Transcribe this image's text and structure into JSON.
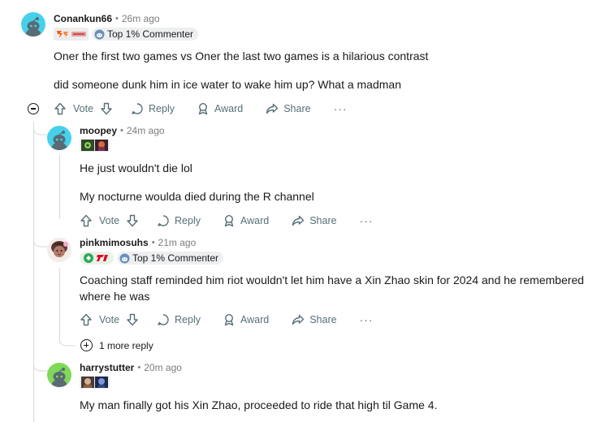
{
  "comments": [
    {
      "username": "Conankun66",
      "time": "26m ago",
      "flair_text": "Top 1% Commenter",
      "flair_icons": [
        "fnatic-logo-icon",
        "team-badge-icon"
      ],
      "paragraphs": [
        "Oner the first two games vs Oner the last two games is a hilarious contrast",
        "did someone dunk him in ice water to wake him up? What a madman"
      ],
      "avatar_color": "#46d1eb"
    },
    {
      "username": "moopey",
      "time": "24m ago",
      "flair_icons": [
        "champion-icon-1",
        "champion-icon-2"
      ],
      "paragraphs": [
        "He just wouldn't die lol",
        "My nocturne woulda died during the R channel"
      ],
      "avatar_color": "#46d1eb"
    },
    {
      "username": "pinkmimosuhs",
      "time": "21m ago",
      "flair_text": "Top 1% Commenter",
      "flair_icons": [
        "t1-logo-icon"
      ],
      "paragraphs": [
        "Coaching staff reminded him riot wouldn't let him have a Xin Zhao skin for 2024 and he remembered where he was"
      ]
    },
    {
      "username": "harrystutter",
      "time": "20m ago",
      "flair_icons": [
        "champion-icon-3",
        "champion-icon-4"
      ],
      "paragraphs": [
        "My man finally got his Xin Zhao, proceeded to ride that high til Game 4."
      ],
      "avatar_color": "#7ed957"
    }
  ],
  "actions": {
    "vote": "Vote",
    "reply": "Reply",
    "award": "Award",
    "share": "Share",
    "more": "···"
  },
  "more_replies": "1 more reply",
  "separator": "•",
  "colors": {
    "text": "#1a1a1b",
    "meta": "#7c7c7c",
    "action": "#576f76",
    "thread_line": "#d7dadc",
    "flair_bg": "#edeff1"
  }
}
